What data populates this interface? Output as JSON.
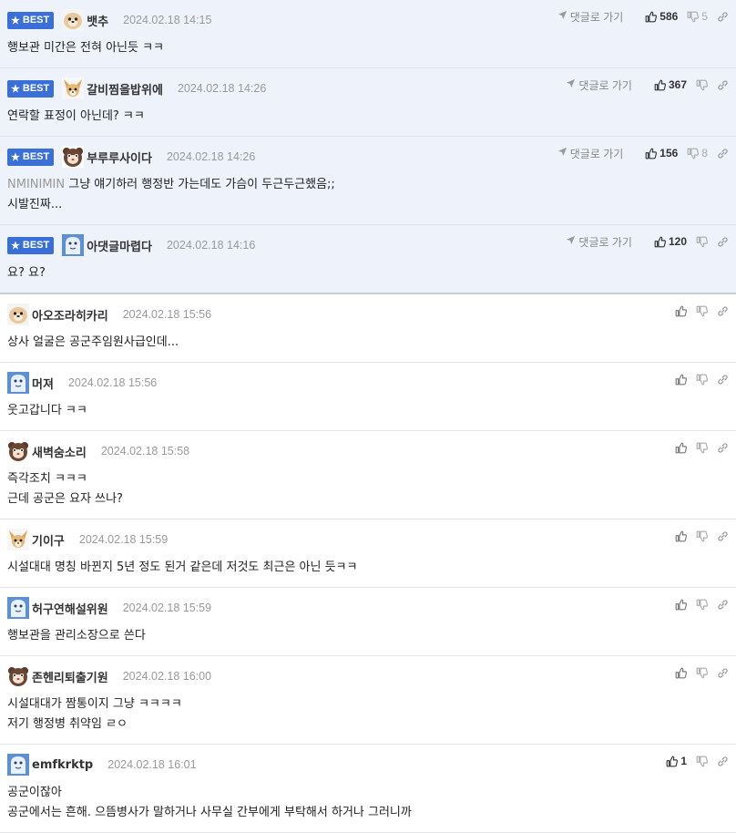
{
  "labels": {
    "best": "BEST",
    "goto": "댓글로 가기"
  },
  "comments": [
    {
      "best": true,
      "avatar": "dog-avatar",
      "nick": "뱃추",
      "date": "2024.02.18 14:15",
      "goto": true,
      "up": "586",
      "down": "5",
      "lines": [
        "행보관 미간은 전혀 아닌듯 ㅋㅋ"
      ]
    },
    {
      "best": true,
      "avatar": "chihuahua-avatar",
      "nick": "갈비찜을밥위에",
      "date": "2024.02.18 14:26",
      "goto": true,
      "up": "367",
      "down": "",
      "lines": [
        "연락할 표정이 아닌데? ㅋㅋ"
      ]
    },
    {
      "best": true,
      "avatar": "bear-avatar",
      "nick": "부루루사이다",
      "date": "2024.02.18 14:26",
      "goto": true,
      "up": "156",
      "down": "8",
      "prefix": "NMINIMIN",
      "lines": [
        "그냥 얘기하러 행정반 가는데도 가슴이 두근두근했음;;",
        "시발진짜..."
      ]
    },
    {
      "best": true,
      "avatar": "ghost-avatar",
      "nick": "아댓글마렵다",
      "date": "2024.02.18 14:16",
      "goto": true,
      "up": "120",
      "down": "",
      "lines": [
        "요? 요?"
      ]
    },
    {
      "best": false,
      "avatar": "dog-avatar",
      "nick": "아오조라히카리",
      "date": "2024.02.18 15:56",
      "goto": false,
      "up": "",
      "down": "",
      "lines": [
        "상사 얼굴은 공군주임원사급인데..."
      ]
    },
    {
      "best": false,
      "avatar": "ghost-avatar",
      "nick": "머져",
      "date": "2024.02.18 15:56",
      "goto": false,
      "up": "",
      "down": "",
      "lines": [
        "웃고갑니다 ㅋㅋ"
      ]
    },
    {
      "best": false,
      "avatar": "bear-avatar",
      "nick": "새벽숨소리",
      "date": "2024.02.18 15:58",
      "goto": false,
      "up": "",
      "down": "",
      "lines": [
        "즉각조치 ㅋㅋㅋ",
        "근데 공군은 요자 쓰나?"
      ]
    },
    {
      "best": false,
      "avatar": "chihuahua-avatar",
      "nick": "기이구",
      "date": "2024.02.18 15:59",
      "goto": false,
      "up": "",
      "down": "",
      "lines": [
        "시설대대 명칭 바뀐지 5년 정도 된거 같은데 저것도 최근은 아닌 듯ㅋㅋ"
      ]
    },
    {
      "best": false,
      "avatar": "ghost-avatar",
      "nick": "허구연해설위원",
      "date": "2024.02.18 15:59",
      "goto": false,
      "up": "",
      "down": "",
      "lines": [
        "행보관을 관리소장으로 쓴다"
      ]
    },
    {
      "best": false,
      "avatar": "bear-avatar",
      "nick": "존헨리퇴출기원",
      "date": "2024.02.18 16:00",
      "goto": false,
      "up": "",
      "down": "",
      "lines": [
        "시설대대가 짬통이지 그냥 ㅋㅋㅋㅋ",
        "저기 행정병 취약임 ㄹㅇ"
      ]
    },
    {
      "best": false,
      "avatar": "ghost-avatar",
      "nick": "emfkrktp",
      "date": "2024.02.18 16:01",
      "goto": false,
      "up": "1",
      "down": "",
      "lines": [
        "공군이잖아",
        "공군에서는 흔해. 으뜸병사가 말하거나 사무실 간부에게 부탁해서 하거나 그러니까"
      ]
    }
  ]
}
